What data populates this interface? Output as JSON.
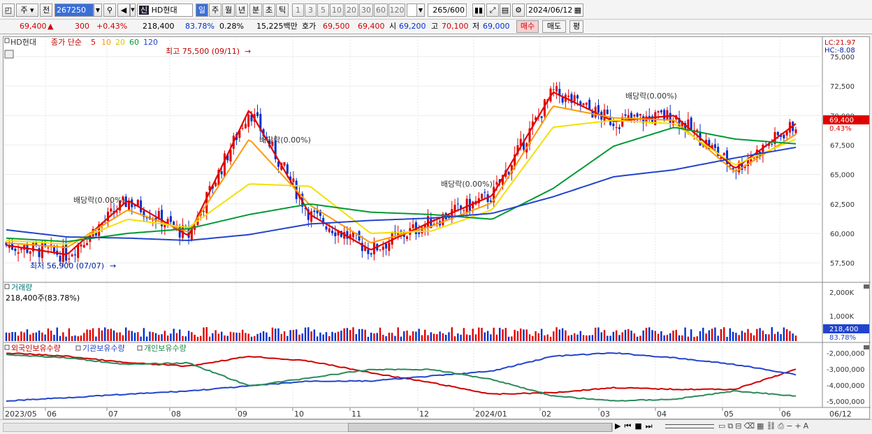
{
  "toolbar": {
    "type_label": "주",
    "prev_label": "전",
    "code": "267250",
    "stock_tag": "신",
    "stock_name": "HD현대",
    "periods": [
      "일",
      "주",
      "월",
      "년",
      "분",
      "초",
      "틱"
    ],
    "active_period": "일",
    "intervals": [
      "1",
      "3",
      "5",
      "10",
      "20",
      "30",
      "60",
      "120"
    ],
    "count": "265",
    "count_total": "/600",
    "date": "2024/06/12"
  },
  "quote": {
    "price": "69,400",
    "change_arrow": "▲",
    "change": "300",
    "change_pct": "+0.43%",
    "volume": "218,400",
    "vol_ratio": "83.78%",
    "turnover": "0.28%",
    "amount": "15,225백만",
    "ask_label": "호가",
    "ask1": "69,500",
    "bid1": "69,400",
    "open_label": "시",
    "open": "69,200",
    "high_label": "고",
    "high": "70,100",
    "low_label": "저",
    "low": "69,000",
    "buy_label": "매수",
    "sell_label": "매도",
    "eval_label": "평"
  },
  "legend": {
    "name": "HD현대",
    "series_label": "종가 단순",
    "ma": [
      {
        "period": "5",
        "color": "#e00000"
      },
      {
        "period": "10",
        "color": "#ff9900"
      },
      {
        "period": "20",
        "color": "#f2e000"
      },
      {
        "period": "60",
        "color": "#009933"
      },
      {
        "period": "120",
        "color": "#2244cc"
      }
    ]
  },
  "annotations": {
    "high": "최고 75,500 (09/11)",
    "low": "최저 56,900 (07/07)",
    "div1": "배당락(0.00%)",
    "div2": "배당락(0.00%)",
    "div3": "배당락(0.00%)",
    "div4": "배당락(0.00%)"
  },
  "price_axis": {
    "lc": "LC:21.97",
    "hc": "HC:-8.08",
    "ticks": [
      "75,000",
      "72,500",
      "70,000",
      "67,500",
      "65,000",
      "62,500",
      "60,000",
      "57,500"
    ],
    "current": "69,400",
    "current_pct": "0.43%"
  },
  "volume_panel": {
    "title": "거래량",
    "info": "218,400주(83.78%)",
    "ticks": [
      "2,000K",
      "1,000K"
    ],
    "current": "218,400",
    "current_pct": "83.78%"
  },
  "holding_panel": {
    "labels": [
      "외국인보유수량",
      "기관보유수량",
      "개인보유수량"
    ],
    "ticks": [
      "-2,000,000",
      "-3,000,000",
      "-4,000,000",
      "-5,000,000"
    ]
  },
  "date_axis": {
    "labels": [
      "2023/05",
      "06",
      "07",
      "08",
      "09",
      "10",
      "11",
      "12",
      "2024/01",
      "02",
      "03",
      "04",
      "05",
      "06"
    ],
    "end_label": "06/12"
  },
  "chart_data": {
    "type": "candlestick",
    "symbol": "HD현대 (267250)",
    "period": "daily",
    "ylim": [
      56500,
      76300
    ],
    "x": [
      "2023/05",
      "06",
      "07",
      "08",
      "09",
      "10",
      "11",
      "12",
      "2024/01",
      "02",
      "03",
      "04",
      "05",
      "06"
    ],
    "close_approx": [
      59200,
      58500,
      61500,
      60200,
      70200,
      61200,
      58800,
      60900,
      62800,
      71500,
      69200,
      69800,
      66000,
      69400
    ],
    "series": [
      {
        "name": "5",
        "values": [
          59000,
          58200,
          62800,
          59800,
          70500,
          61600,
          58600,
          61000,
          63200,
          72000,
          69500,
          70000,
          65500,
          69300
        ]
      },
      {
        "name": "10",
        "values": [
          59200,
          58800,
          62000,
          60100,
          68000,
          62400,
          59200,
          60600,
          62600,
          70800,
          69800,
          69600,
          65200,
          68400
        ]
      },
      {
        "name": "20",
        "values": [
          59400,
          59100,
          61200,
          60500,
          64200,
          64000,
          60000,
          60200,
          62000,
          69000,
          69600,
          69300,
          65800,
          68000
        ]
      },
      {
        "name": "60",
        "values": [
          59600,
          59300,
          60000,
          60400,
          61600,
          62500,
          61800,
          61600,
          61200,
          63800,
          67400,
          69000,
          68000,
          67600
        ]
      },
      {
        "name": "120",
        "values": [
          60300,
          59700,
          59600,
          59400,
          59900,
          60800,
          61100,
          61300,
          61700,
          63100,
          64800,
          65400,
          66400,
          67300
        ]
      }
    ],
    "high": {
      "value": 75500,
      "date": "09/11"
    },
    "low": {
      "value": 56900,
      "date": "07/07"
    },
    "last": {
      "price": 69400,
      "change": 300,
      "change_pct": 0.43,
      "volume": 218400
    }
  }
}
